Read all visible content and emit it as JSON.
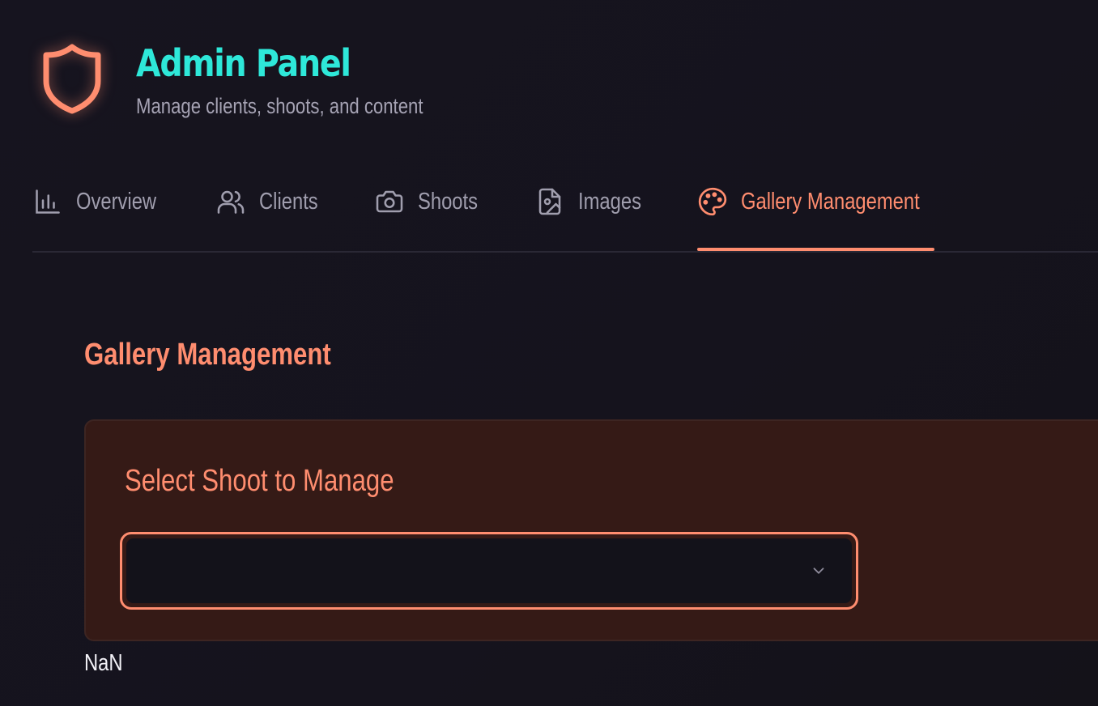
{
  "header": {
    "title": "Admin Panel",
    "subtitle": "Manage clients, shoots, and content",
    "logo_icon": "shield-icon"
  },
  "tabs": [
    {
      "label": "Overview",
      "icon": "bar-chart-icon",
      "active": false
    },
    {
      "label": "Clients",
      "icon": "users-icon",
      "active": false
    },
    {
      "label": "Shoots",
      "icon": "camera-icon",
      "active": false
    },
    {
      "label": "Images",
      "icon": "image-file-icon",
      "active": false
    },
    {
      "label": "Gallery Management",
      "icon": "palette-icon",
      "active": true
    }
  ],
  "main": {
    "section_title": "Gallery Management",
    "card": {
      "title": "Select Shoot to Manage",
      "select": {
        "value": "",
        "icon": "chevron-down-icon"
      }
    },
    "status_text": "NaN"
  },
  "colors": {
    "accent": "#ff8d6f",
    "title": "#2ee8d9",
    "background": "#15131e",
    "card_background": "#351a16",
    "muted_text": "#a09eae"
  }
}
